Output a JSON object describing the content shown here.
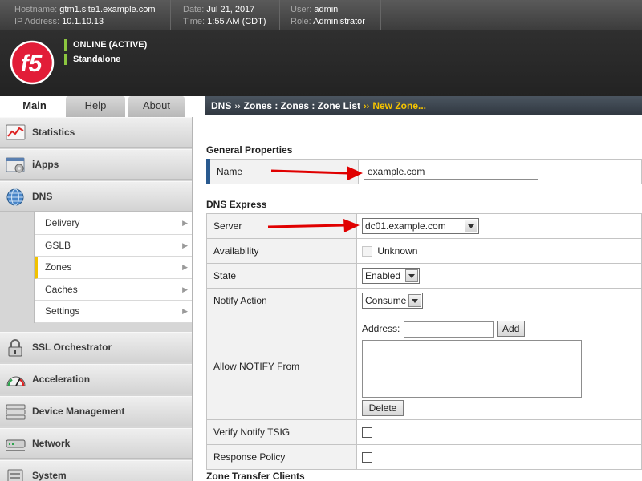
{
  "topbar": {
    "hostname_label": "Hostname:",
    "hostname": "gtm1.site1.example.com",
    "ip_label": "IP Address:",
    "ip": "10.1.10.13",
    "date_label": "Date:",
    "date": "Jul 21, 2017",
    "time_label": "Time:",
    "time": "1:55 AM (CDT)",
    "user_label": "User:",
    "user": "admin",
    "role_label": "Role:",
    "role": "Administrator"
  },
  "header": {
    "status": "ONLINE (ACTIVE)",
    "mode": "Standalone",
    "status_color": "#8cc63f",
    "logo_text": "f5"
  },
  "tabs": [
    {
      "label": "Main",
      "active": true
    },
    {
      "label": "Help"
    },
    {
      "label": "About"
    }
  ],
  "breadcrumb": {
    "root": "DNS",
    "sep": "››",
    "path": "Zones : Zones : Zone List",
    "current": "New Zone..."
  },
  "sidebar": {
    "sections": [
      {
        "label": "Statistics",
        "icon": "statistics-icon"
      },
      {
        "label": "iApps",
        "icon": "iapps-icon"
      },
      {
        "label": "DNS",
        "icon": "dns-globe-icon"
      },
      {
        "label": "SSL Orchestrator",
        "icon": "lock-icon"
      },
      {
        "label": "Acceleration",
        "icon": "gauge-icon"
      },
      {
        "label": "Device Management",
        "icon": "server-icon"
      },
      {
        "label": "Network",
        "icon": "network-icon"
      },
      {
        "label": "System",
        "icon": "system-icon"
      }
    ],
    "dns_items": [
      {
        "label": "Delivery"
      },
      {
        "label": "GSLB"
      },
      {
        "label": "Zones",
        "active": true
      },
      {
        "label": "Caches"
      },
      {
        "label": "Settings"
      }
    ],
    "arrow": "▶"
  },
  "general": {
    "title": "General Properties",
    "name_label": "Name",
    "name_value": "example.com"
  },
  "dns_express": {
    "title": "DNS Express",
    "server_label": "Server",
    "server_value": "dc01.example.com",
    "availability_label": "Availability",
    "availability_value": "Unknown",
    "state_label": "State",
    "state_value": "Enabled",
    "notify_action_label": "Notify Action",
    "notify_action_value": "Consume",
    "allow_notify_label": "Allow NOTIFY From",
    "address_label": "Address:",
    "address_value": "",
    "add_button": "Add",
    "delete_button": "Delete",
    "verify_tsig_label": "Verify Notify TSIG",
    "response_policy_label": "Response Policy"
  },
  "zone_transfer": {
    "title": "Zone Transfer Clients"
  },
  "colors": {
    "accent_yellow": "#f1c200",
    "arrow_red": "#e00000",
    "breadcrumb_bg": "#3a434c"
  }
}
